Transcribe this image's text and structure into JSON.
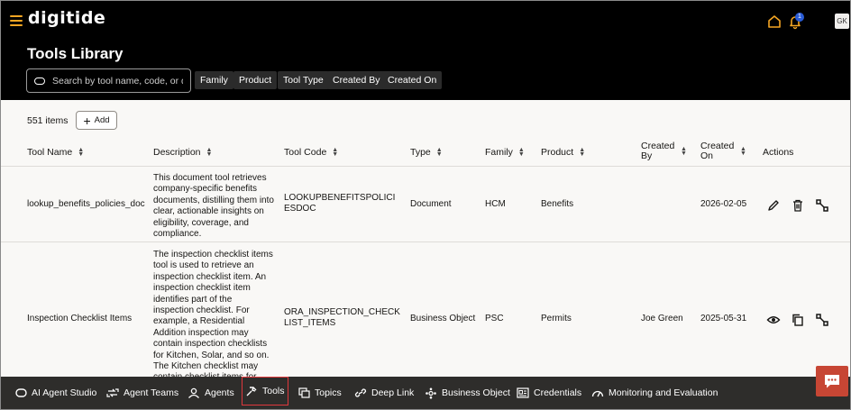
{
  "header": {
    "logo_text": "digitide",
    "notification_count": "1",
    "avatar_initials": "GK",
    "accent_color": "#f5a623"
  },
  "page": {
    "title": "Tools Library"
  },
  "search": {
    "placeholder": "Search by tool name, code, or de..."
  },
  "filters": [
    "Family",
    "Product",
    "Tool Type",
    "Created By",
    "Created On"
  ],
  "toolbar": {
    "count_label": "551 items",
    "add_label": "Add"
  },
  "table": {
    "columns": {
      "name": "Tool Name",
      "description": "Description",
      "code": "Tool Code",
      "type": "Type",
      "family": "Family",
      "product": "Product",
      "created_by": "Created By",
      "created_on": "Created On",
      "actions": "Actions"
    },
    "rows": [
      {
        "name": "lookup_benefits_policies_doc",
        "description": "This document tool retrieves company-specific benefits documents, distilling them into clear, actionable insights on eligibility, coverage, and compliance.",
        "code": "LOOKUPBENEFITSPOLICIESDOC",
        "type": "Document",
        "family": "HCM",
        "product": "Benefits",
        "created_by": "",
        "created_on": "2026-02-05",
        "actions": [
          "edit-icon",
          "delete-icon",
          "duplicate-icon"
        ]
      },
      {
        "name": "Inspection Checklist Items",
        "description": "The inspection checklist items tool is used to retrieve an inspection checklist item. An inspection checklist item identifies part of the inspection checklist. For example, a Residential Addition inspection may contain inspection checklists for Kitchen, Solar, and so on. The Kitchen checklist may contain checklist items for Plumbing and",
        "code": "ORA_INSPECTION_CHECKLIST_ITEMS",
        "type": "Business Object",
        "family": "PSC",
        "product": "Permits",
        "created_by": "Joe Green",
        "created_on": "2025-05-31",
        "actions": [
          "view-icon",
          "copy-icon",
          "duplicate-icon"
        ]
      }
    ]
  },
  "bottom_nav": {
    "items": [
      {
        "label": "AI Agent Studio",
        "icon": "agent-studio-icon"
      },
      {
        "label": "Agent Teams",
        "icon": "agent-teams-icon"
      },
      {
        "label": "Agents",
        "icon": "agents-icon"
      },
      {
        "label": "Tools",
        "icon": "tools-icon",
        "active": true
      },
      {
        "label": "Topics",
        "icon": "topics-icon"
      },
      {
        "label": "Deep Link",
        "icon": "link-icon"
      },
      {
        "label": "Business Object",
        "icon": "business-object-icon"
      },
      {
        "label": "Credentials",
        "icon": "credentials-icon"
      },
      {
        "label": "Monitoring and Evaluation",
        "icon": "monitoring-icon"
      }
    ],
    "active_color": "#e0383c"
  },
  "chat": {
    "icon": "chat-icon",
    "color": "#c74634"
  }
}
